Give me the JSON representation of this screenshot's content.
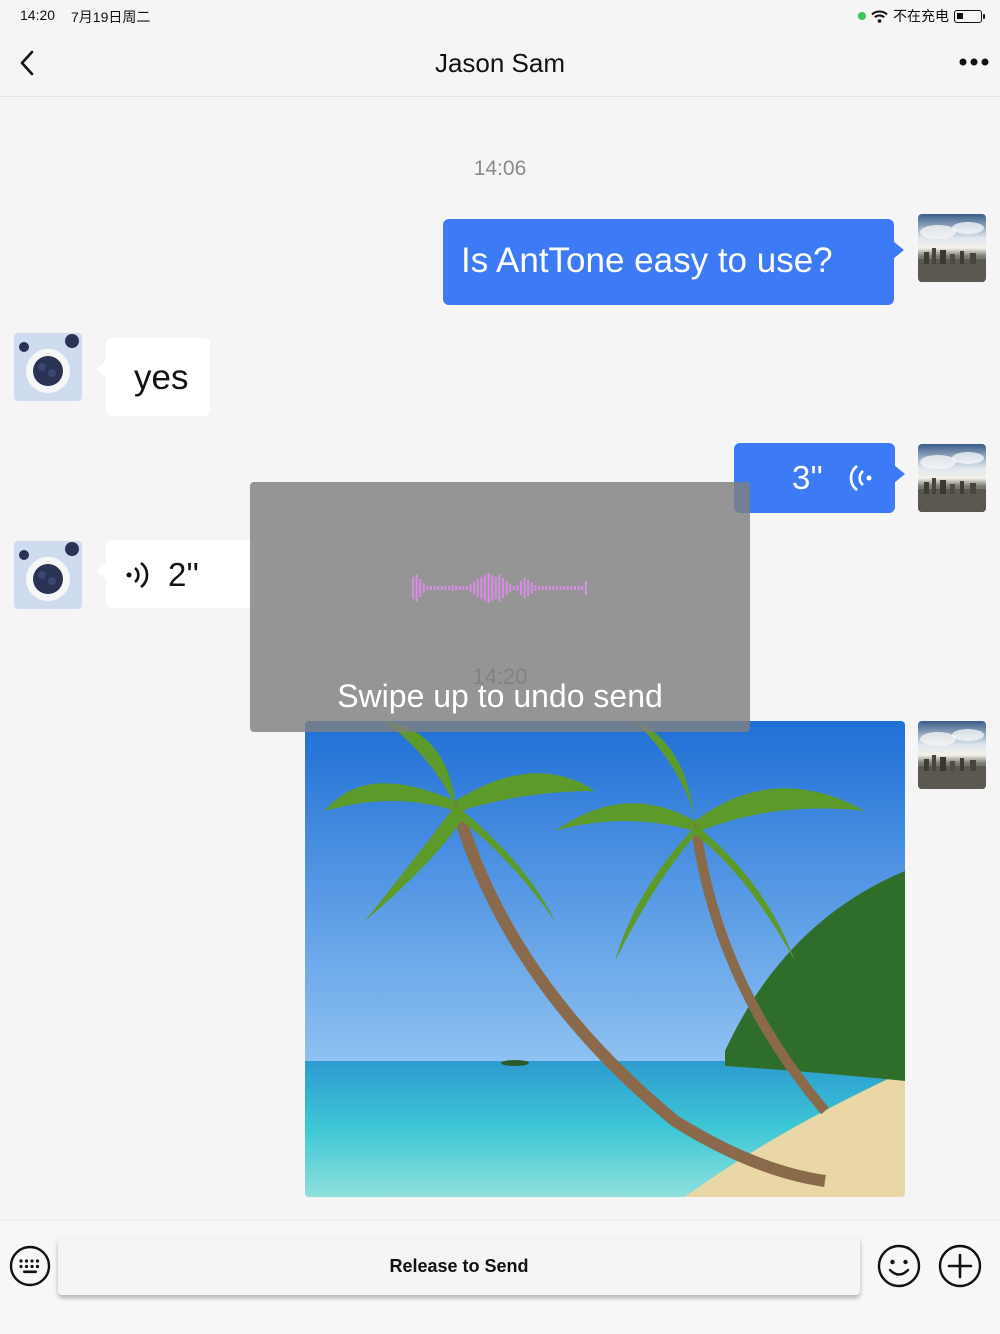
{
  "status_bar": {
    "time": "14:20",
    "date": "7月19日周二",
    "charging_text": "不在充电"
  },
  "nav": {
    "title": "Jason Sam"
  },
  "messages": {
    "timestamp_1": "14:06",
    "text_out": "Is AntTone easy to use?",
    "text_in": "yes",
    "voice_out_duration": "3''",
    "voice_in_duration": "2''",
    "timestamp_2": "14:20"
  },
  "overlay": {
    "hint": "Swipe up to undo send"
  },
  "input_bar": {
    "release_label": "Release to Send"
  },
  "icons": {
    "back": "chevron-left-icon",
    "more": "more-dots-icon",
    "keyboard": "keyboard-icon",
    "emoji": "emoji-icon",
    "plus": "plus-icon",
    "wifi": "wifi-icon",
    "battery": "battery-icon"
  },
  "colors": {
    "accent": "#3d7bf6",
    "waveform": "#d98ce6"
  }
}
